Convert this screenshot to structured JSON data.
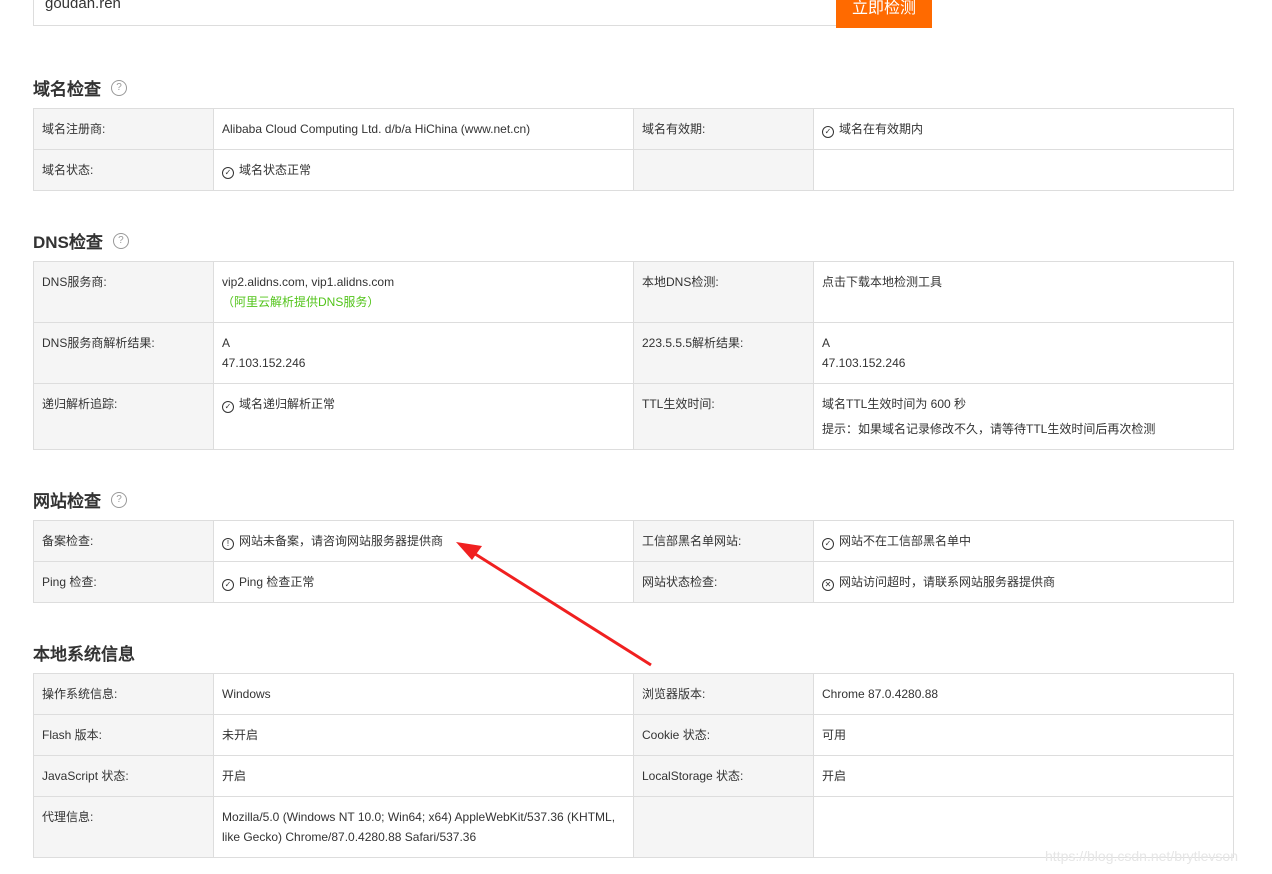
{
  "search": {
    "value": "goudan.ren",
    "button": "立即检测"
  },
  "domain_section": {
    "title": "域名检查",
    "help_icon": "?",
    "rows": [
      {
        "l1": "域名注册商:",
        "v1": "Alibaba Cloud Computing Ltd. d/b/a HiChina (www.net.cn)",
        "l2": "域名有效期:",
        "v2": "域名在有效期内"
      },
      {
        "l1": "域名状态:",
        "v1": "域名状态正常",
        "l2": "",
        "v2": ""
      }
    ]
  },
  "dns_section": {
    "title": "DNS检查",
    "help_icon": "?",
    "rows": [
      {
        "l1": "DNS服务商:",
        "v1a": "vip2.alidns.com, vip1.alidns.com",
        "v1b": "（阿里云解析提供DNS服务）",
        "l2": "本地DNS检测:",
        "v2": "点击下载本地检测工具"
      },
      {
        "l1": "DNS服务商解析结果:",
        "v1a": "A",
        "v1b": "47.103.152.246",
        "l2": "223.5.5.5解析结果:",
        "v2a": "A",
        "v2b": "47.103.152.246"
      },
      {
        "l1": "递归解析追踪:",
        "v1": "域名递归解析正常",
        "l2": "TTL生效时间:",
        "v2a": "域名TTL生效时间为 600 秒",
        "v2b": "提示：如果域名记录修改不久，请等待TTL生效时间后再次检测"
      }
    ]
  },
  "site_section": {
    "title": "网站检查",
    "help_icon": "?",
    "rows": [
      {
        "l1": "备案检查:",
        "v1": "网站未备案，请咨询网站服务器提供商",
        "l2": "工信部黑名单网站:",
        "v2": "网站不在工信部黑名单中"
      },
      {
        "l1": "Ping 检查:",
        "v1": "Ping 检查正常",
        "l2": "网站状态检查:",
        "v2": "网站访问超时，请联系网站服务器提供商"
      }
    ]
  },
  "local_section": {
    "title": "本地系统信息",
    "rows": [
      {
        "l1": "操作系统信息:",
        "v1": "Windows",
        "l2": "浏览器版本:",
        "v2": "Chrome 87.0.4280.88"
      },
      {
        "l1": "Flash 版本:",
        "v1": "未开启",
        "l2": "Cookie 状态:",
        "v2": "可用"
      },
      {
        "l1": "JavaScript 状态:",
        "v1": "开启",
        "l2": "LocalStorage 状态:",
        "v2": "开启"
      },
      {
        "l1": "代理信息:",
        "v1": "Mozilla/5.0 (Windows NT 10.0; Win64; x64) AppleWebKit/537.36 (KHTML, like Gecko) Chrome/87.0.4280.88 Safari/537.36",
        "l2": "",
        "v2": ""
      }
    ]
  },
  "status_icons": {
    "ok": "✓",
    "warn": "!",
    "err": "✕"
  },
  "colors": {
    "accent": "#ff6a00",
    "ok": "#52c41a",
    "warn": "#f5a623",
    "error": "#f04134",
    "link": "#2fb0c7",
    "arrow": "#f02020"
  },
  "watermark": "https://blog.csdn.net/brytlevson"
}
